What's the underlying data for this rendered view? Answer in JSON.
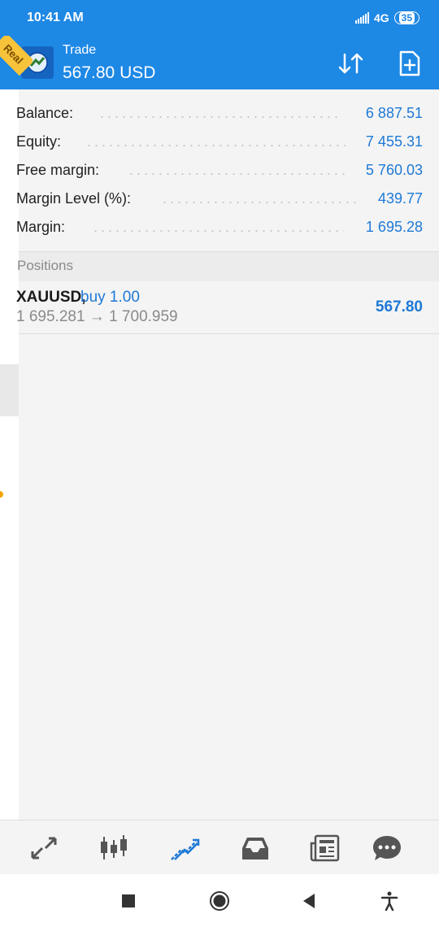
{
  "status_bar": {
    "time": "10:41 AM",
    "network": "4G",
    "battery": "35"
  },
  "header": {
    "title": "Trade",
    "amount": "567.80 USD",
    "icons": {
      "logo": "metatrader-logo-icon",
      "sort": "sort-arrows-icon",
      "new_order": "new-order-icon"
    }
  },
  "sidebar": {
    "badge_text": "Real"
  },
  "summary": [
    {
      "label": "Balance:",
      "value": "6 887.51"
    },
    {
      "label": "Equity:",
      "value": "7 455.31"
    },
    {
      "label": "Free margin:",
      "value": "5 760.03"
    },
    {
      "label": "Margin Level (%):",
      "value": "439.77"
    },
    {
      "label": "Margin:",
      "value": "1 695.28"
    }
  ],
  "positions": {
    "header": "Positions",
    "items": [
      {
        "symbol": "XAUUSD,",
        "direction": "buy 1.00",
        "prices": "1 695.281 → 1 700.959",
        "profit": "567.80"
      }
    ]
  },
  "tabs": [
    {
      "name": "quotes",
      "icon": "quotes-arrows-icon",
      "active": false
    },
    {
      "name": "chart",
      "icon": "candlestick-chart-icon",
      "active": false
    },
    {
      "name": "trade",
      "icon": "trade-arrows-icon",
      "active": true
    },
    {
      "name": "history",
      "icon": "inbox-history-icon",
      "active": false
    },
    {
      "name": "news",
      "icon": "newspaper-icon",
      "active": false
    },
    {
      "name": "messages",
      "icon": "chat-bubble-icon",
      "active": false
    }
  ],
  "colors": {
    "primary": "#1e88e5",
    "value_blue": "#1e79d6",
    "badge_yellow": "#f6c33a"
  }
}
